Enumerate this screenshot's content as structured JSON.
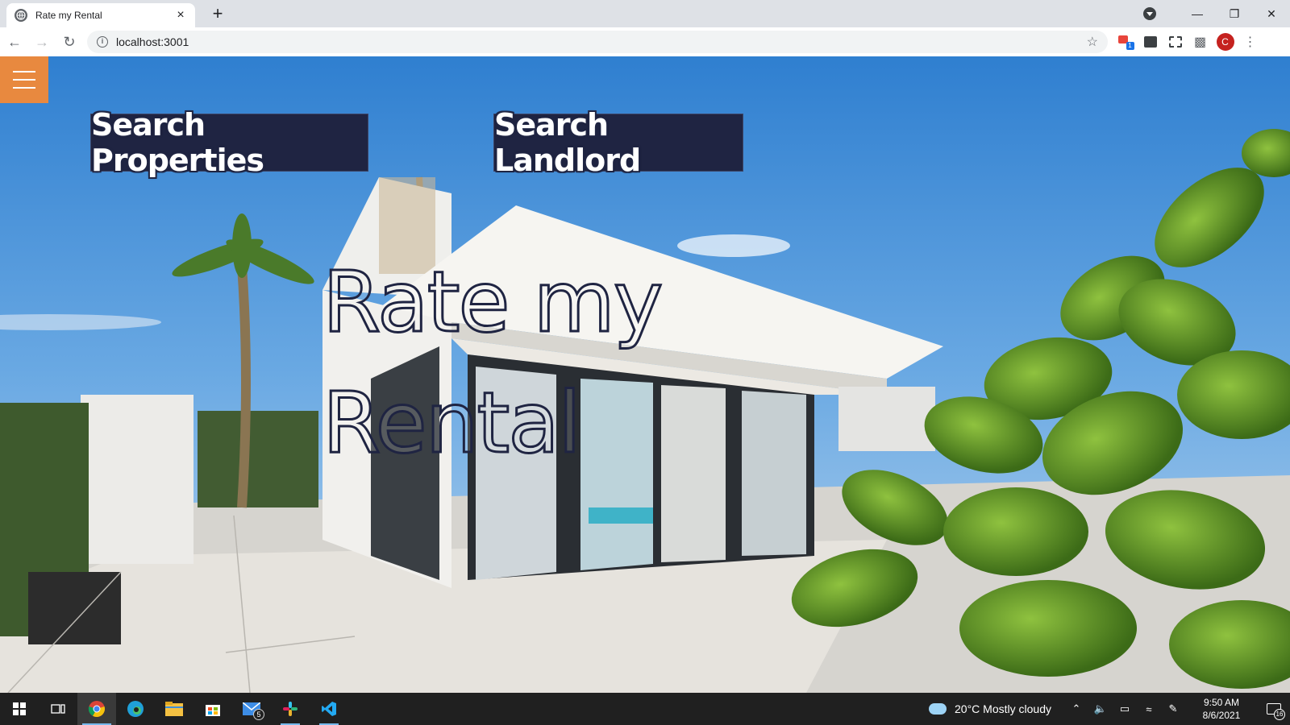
{
  "browser": {
    "tab_title": "Rate my Rental",
    "url": "localhost:3001",
    "profile_initial": "C",
    "ext_badge": "1"
  },
  "page": {
    "buttons": {
      "search_properties": "Search Properties",
      "search_landlord": "Search Landlord"
    },
    "hero_title": "Rate my Rental"
  },
  "taskbar": {
    "mail_badge": "5",
    "weather": "20°C  Mostly cloudy",
    "time": "9:50 AM",
    "date": "8/6/2021",
    "notifications": "16"
  }
}
